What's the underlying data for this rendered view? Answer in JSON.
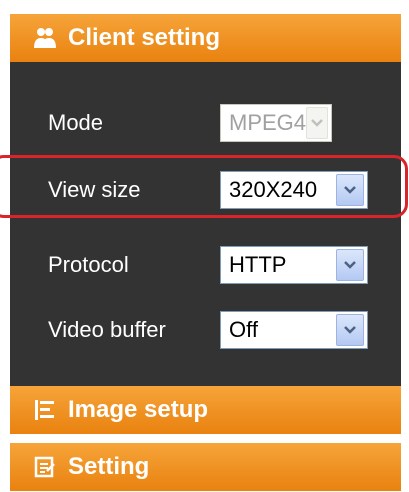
{
  "client_setting": {
    "title": "Client setting",
    "icon": "users-icon",
    "rows": [
      {
        "label": "Mode",
        "value": "MPEG4",
        "disabled": true
      },
      {
        "label": "View size",
        "value": "320X240",
        "disabled": false
      },
      {
        "label": "Protocol",
        "value": "HTTP",
        "disabled": false
      },
      {
        "label": "Video buffer",
        "value": "Off",
        "disabled": false
      }
    ]
  },
  "image_setup": {
    "title": "Image setup",
    "icon": "image-setup-icon"
  },
  "setting": {
    "title": "Setting",
    "icon": "setting-icon"
  },
  "colors": {
    "header_orange": "#e9820f",
    "panel_dark": "#333333",
    "highlight_red": "#d8242a"
  }
}
